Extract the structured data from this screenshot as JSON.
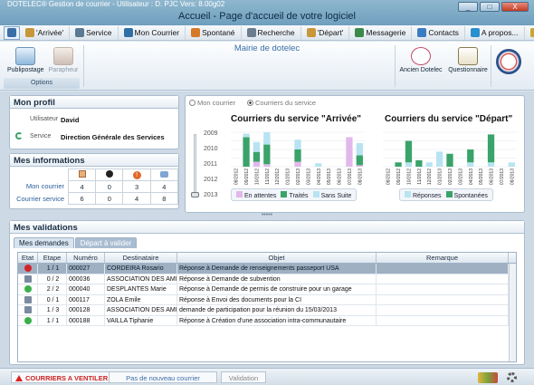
{
  "window": {
    "app_title": "DOTELEC® Gestion de courrier - Utilisateur : D. PJC  Vers: 8.00g02",
    "page_title": "Accueil - Page d'accueil de votre logiciel",
    "buttons": [
      "_",
      "□",
      "X"
    ]
  },
  "menu": [
    {
      "label": "",
      "icon": "home-icon",
      "color": "#3a6ea8"
    },
    {
      "label": "'Arrivée'",
      "icon": "inbox-icon",
      "color": "#c8973a"
    },
    {
      "label": "Service",
      "icon": "gear-icon",
      "color": "#5b7a93"
    },
    {
      "label": "Mon Courrier",
      "icon": "people-icon",
      "color": "#2f6fa6"
    },
    {
      "label": "Spontané",
      "icon": "pencil-icon",
      "color": "#d67a2a"
    },
    {
      "label": "Recherche",
      "icon": "search-icon",
      "color": "#6b7d8e"
    },
    {
      "label": "'Départ'",
      "icon": "outbox-icon",
      "color": "#c8973a"
    },
    {
      "label": "Messagerie",
      "icon": "mail-icon",
      "color": "#3c8a4a"
    },
    {
      "label": "Contacts",
      "icon": "contacts-icon",
      "color": "#3a7cc0"
    },
    {
      "label": "A propos...",
      "icon": "info-icon",
      "color": "#2a8fcf"
    },
    {
      "label": "",
      "icon": "key-icon",
      "color": "#c9a531"
    }
  ],
  "ribbon": {
    "mairie": "Mairie de dotelec",
    "publipostage": "Publipostage",
    "parapheur": "Parapheur",
    "group_label": "Options",
    "ancien": "Ancien Dotelec",
    "questionnaire": "Questionnaire"
  },
  "profil": {
    "title": "Mon profil",
    "user_label": "Utilisateur",
    "user_value": "David",
    "service_label": "Service",
    "service_value": "Direction Générale des Services"
  },
  "infos": {
    "title": "Mes informations",
    "rows": [
      {
        "label": "Mon courrier",
        "values": [
          "4",
          "0",
          "3",
          "4"
        ]
      },
      {
        "label": "Courrier service",
        "values": [
          "6",
          "0",
          "4",
          "8"
        ]
      }
    ],
    "header_icons": [
      "document-icon",
      "bomb-icon",
      "alert-icon",
      "reply-icon"
    ]
  },
  "charts_panel": {
    "radio_mine": "Mon courrier",
    "radio_service": "Courriers du service",
    "years": [
      "2009",
      "2010",
      "2011",
      "2012",
      "2013"
    ]
  },
  "chart_data": [
    {
      "type": "bar",
      "title": "Courriers du service \"Arrivée\"",
      "categories": [
        "08/2012",
        "09/2012",
        "10/2012",
        "11/2012",
        "12/2012",
        "01/2013",
        "02/2013",
        "03/2013",
        "04/2013",
        "05/2013",
        "06/2013",
        "07/2013",
        "08/2013"
      ],
      "ylim": [
        0,
        7
      ],
      "series": [
        {
          "name": "En attentes",
          "color": "#e2b8ec",
          "values": [
            0,
            0,
            1,
            0.5,
            0,
            0,
            1,
            0,
            0,
            0,
            0,
            6,
            0.3
          ]
        },
        {
          "name": "Traités",
          "color": "#3aa36a",
          "values": [
            0,
            6,
            2,
            4,
            0,
            0,
            2.5,
            0,
            0,
            0,
            0,
            0,
            2
          ]
        },
        {
          "name": "Sans Suite",
          "color": "#b8e3f2",
          "values": [
            0,
            0.7,
            2,
            2.5,
            0,
            0,
            2,
            0,
            0.7,
            0,
            0,
            0,
            2.5
          ]
        }
      ],
      "legend": "bottom"
    },
    {
      "type": "bar",
      "title": "Courriers du service \"Départ\"",
      "categories": [
        "08/2012",
        "09/2012",
        "10/2012",
        "11/2012",
        "12/2012",
        "01/2013",
        "02/2013",
        "03/2013",
        "04/2013",
        "05/2013",
        "06/2013",
        "07/2013",
        "08/2013"
      ],
      "ylim": [
        0,
        16
      ],
      "series": [
        {
          "name": "Réponses",
          "color": "#b8e3f2",
          "values": [
            0,
            0,
            2,
            0,
            2,
            7,
            0,
            0,
            2,
            0,
            2,
            0,
            2
          ]
        },
        {
          "name": "Spontanées",
          "color": "#3aa36a",
          "values": [
            0,
            2,
            10,
            3,
            0,
            0,
            6,
            0,
            6,
            0,
            13,
            0,
            0
          ]
        }
      ],
      "legend": "bottom"
    }
  ],
  "validations": {
    "title": "Mes validations",
    "tab_active": "Mes demandes",
    "tab_inactive": "Départ à valider",
    "columns": [
      "Etat",
      "Etape",
      "Numéro",
      "Destinataire",
      "Objet",
      "Remarque"
    ],
    "rows": [
      {
        "state": "error",
        "etape": "1 / 1",
        "numero": "000027",
        "dest": "CORDEIRA Rosario",
        "objet": "Réponse à Demande de renseignements passeport USA",
        "remarque": ""
      },
      {
        "state": "pending",
        "etape": "0 / 2",
        "numero": "000036",
        "dest": "ASSOCIATION DES AMIS",
        "objet": "Réponse à Demande de subvention",
        "remarque": ""
      },
      {
        "state": "ok",
        "etape": "2 / 2",
        "numero": "000040",
        "dest": "DESPLANTES Marie",
        "objet": "Réponse à Demande de permis de construire pour un garage",
        "remarque": ""
      },
      {
        "state": "pending",
        "etape": "0 / 1",
        "numero": "000117",
        "dest": "ZOLA Emile",
        "objet": "Réponse à Envoi des documents pour la CI",
        "remarque": ""
      },
      {
        "state": "pending",
        "etape": "1 / 3",
        "numero": "000128",
        "dest": "ASSOCIATION DES AMIS",
        "objet": "demande de participation pour la réunion du 15/03/2013",
        "remarque": ""
      },
      {
        "state": "ok",
        "etape": "1 / 1",
        "numero": "000188",
        "dest": "VAILLA Tiphanie",
        "objet": "Réponse à Création d'une association intra-communautaire",
        "remarque": ""
      }
    ]
  },
  "status": {
    "ventiler": "COURRIERS A VENTILER",
    "nouveau": "Pas de nouveau courrier",
    "validation": "Validation"
  },
  "colors": {
    "accent": "#3a6ea8",
    "ok": "#3bb04a",
    "error": "#d2262b",
    "pending": "#7a8aa0"
  }
}
